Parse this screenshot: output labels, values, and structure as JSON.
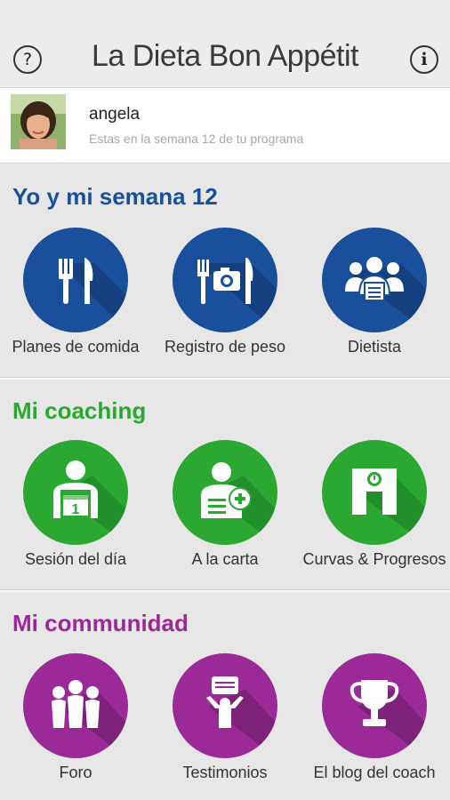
{
  "header": {
    "title": "La Dieta Bon Appétit",
    "help_label": "?",
    "info_label": "i"
  },
  "profile": {
    "name": "angela",
    "subtitle": "Estas en la semana 12  de tu programa"
  },
  "sections": [
    {
      "title": "Yo y mi semana 12",
      "color": "#1a4f9c",
      "items": [
        {
          "label": "Planes de comida",
          "icon": "cutlery-icon"
        },
        {
          "label": "Registro de peso",
          "icon": "camera-cutlery-icon"
        },
        {
          "label": "Dietista",
          "icon": "group-icon"
        }
      ]
    },
    {
      "title": "Mi coaching",
      "color": "#2aa832",
      "items": [
        {
          "label": "Sesión del día",
          "icon": "calendar-person-icon"
        },
        {
          "label": "A la carta",
          "icon": "person-add-icon"
        },
        {
          "label": "Curvas & Progresos",
          "icon": "scale-icon"
        }
      ]
    },
    {
      "title": "Mi communidad",
      "color": "#9b2a98",
      "items": [
        {
          "label": "Foro",
          "icon": "people-icon"
        },
        {
          "label": "Testimonios",
          "icon": "testimonial-icon"
        },
        {
          "label": "El  blog del coach",
          "icon": "trophy-icon"
        }
      ]
    }
  ]
}
